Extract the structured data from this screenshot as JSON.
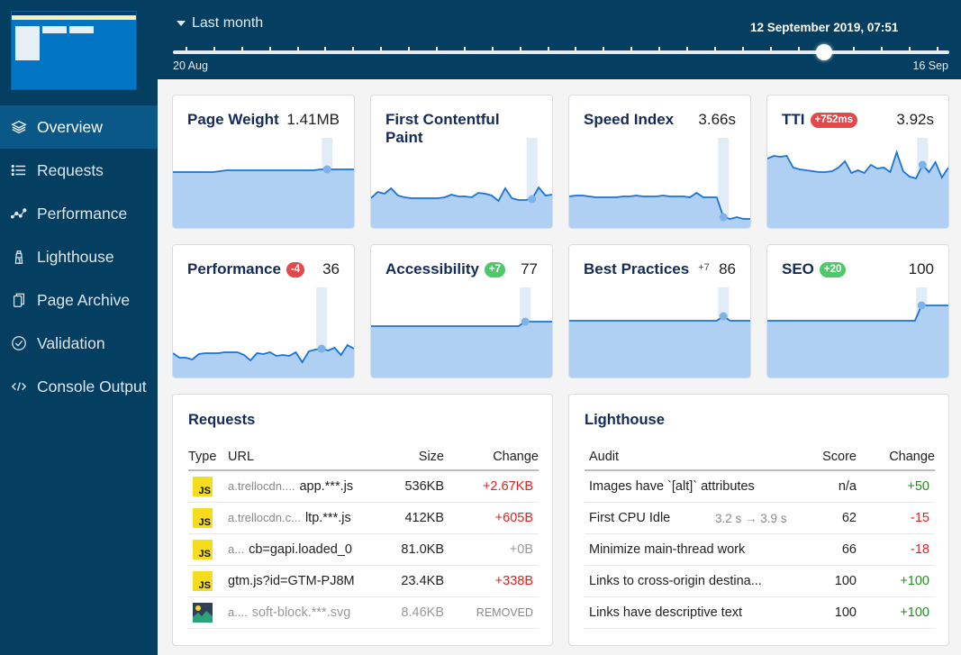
{
  "sidebar": {
    "items": [
      {
        "label": "Overview",
        "icon": "layers-icon",
        "active": true
      },
      {
        "label": "Requests",
        "icon": "list-icon",
        "active": false
      },
      {
        "label": "Performance",
        "icon": "chart-line-icon",
        "active": false
      },
      {
        "label": "Lighthouse",
        "icon": "lighthouse-icon",
        "active": false
      },
      {
        "label": "Page Archive",
        "icon": "copy-icon",
        "active": false
      },
      {
        "label": "Validation",
        "icon": "check-circle-icon",
        "active": false
      },
      {
        "label": "Console Output",
        "icon": "code-icon",
        "active": false
      }
    ]
  },
  "topbar": {
    "range_label": "Last month",
    "current_date": "12 September 2019, 07:51",
    "slider_start": "20 Aug",
    "slider_end": "16 Sep",
    "slider_ticks": 28,
    "slider_position": 0.85
  },
  "metrics": [
    {
      "title": "Page Weight",
      "value": "1.41MB",
      "badge": null,
      "badge_type": null,
      "series": [
        0.62,
        0.62,
        0.62,
        0.62,
        0.62,
        0.62,
        0.62,
        0.63,
        0.64,
        0.64,
        0.64,
        0.64,
        0.64,
        0.64,
        0.64,
        0.64,
        0.64,
        0.64,
        0.64,
        0.64,
        0.64,
        0.64,
        0.65,
        0.65,
        0.65,
        0.65,
        0.65,
        0.65
      ],
      "selected": 23
    },
    {
      "title": "First Contentful Paint",
      "value": "",
      "badge": null,
      "badge_type": null,
      "series": [
        0.33,
        0.4,
        0.38,
        0.44,
        0.36,
        0.34,
        0.33,
        0.33,
        0.33,
        0.33,
        0.33,
        0.34,
        0.37,
        0.35,
        0.35,
        0.34,
        0.39,
        0.38,
        0.36,
        0.3,
        0.44,
        0.33,
        0.31,
        0.31,
        0.32,
        0.45,
        0.36,
        0.37
      ],
      "selected": 24
    },
    {
      "title": "Speed Index",
      "value": "3.66s",
      "badge": null,
      "badge_type": null,
      "series": [
        0.35,
        0.36,
        0.36,
        0.35,
        0.34,
        0.34,
        0.34,
        0.34,
        0.35,
        0.35,
        0.36,
        0.35,
        0.35,
        0.35,
        0.36,
        0.35,
        0.35,
        0.35,
        0.34,
        0.39,
        0.34,
        0.34,
        0.34,
        0.12,
        0.1,
        0.12,
        0.1,
        0.1
      ],
      "selected": 23
    },
    {
      "title": "TTI",
      "value": "3.92s",
      "badge": "+752ms",
      "badge_type": "red",
      "series": [
        0.77,
        0.8,
        0.79,
        0.8,
        0.67,
        0.65,
        0.64,
        0.63,
        0.62,
        0.62,
        0.63,
        0.67,
        0.74,
        0.61,
        0.64,
        0.61,
        0.7,
        0.66,
        0.67,
        0.62,
        0.84,
        0.63,
        0.57,
        0.55,
        0.7,
        0.62,
        0.73,
        0.56,
        0.67
      ],
      "selected": 24
    },
    {
      "title": "Performance",
      "value": "36",
      "badge": "-4",
      "badge_type": "red",
      "series": [
        0.27,
        0.22,
        0.22,
        0.2,
        0.26,
        0.27,
        0.27,
        0.27,
        0.28,
        0.28,
        0.28,
        0.25,
        0.19,
        0.27,
        0.26,
        0.28,
        0.24,
        0.25,
        0.24,
        0.28,
        0.17,
        0.29,
        0.31,
        0.32,
        0.3,
        0.33,
        0.25,
        0.36,
        0.32
      ],
      "selected": 23
    },
    {
      "title": "Accessibility",
      "value": "77",
      "badge": "+7",
      "badge_type": "green",
      "series": [
        0.57,
        0.57,
        0.57,
        0.57,
        0.57,
        0.57,
        0.57,
        0.57,
        0.57,
        0.57,
        0.57,
        0.57,
        0.57,
        0.57,
        0.57,
        0.57,
        0.57,
        0.57,
        0.57,
        0.57,
        0.57,
        0.57,
        0.57,
        0.62,
        0.62,
        0.62,
        0.62,
        0.62
      ],
      "selected": 23
    },
    {
      "title": "Best Practices",
      "value": "86",
      "badge": "+7",
      "badge_type": "plain",
      "series": [
        0.63,
        0.63,
        0.63,
        0.63,
        0.63,
        0.63,
        0.63,
        0.63,
        0.63,
        0.63,
        0.63,
        0.63,
        0.63,
        0.63,
        0.63,
        0.63,
        0.63,
        0.63,
        0.63,
        0.63,
        0.63,
        0.63,
        0.63,
        0.68,
        0.63,
        0.63,
        0.63,
        0.63
      ],
      "selected": 23
    },
    {
      "title": "SEO",
      "value": "100",
      "badge": "+20",
      "badge_type": "green",
      "series": [
        0.63,
        0.63,
        0.63,
        0.63,
        0.63,
        0.63,
        0.63,
        0.63,
        0.63,
        0.63,
        0.63,
        0.63,
        0.63,
        0.63,
        0.63,
        0.63,
        0.63,
        0.63,
        0.63,
        0.63,
        0.63,
        0.63,
        0.63,
        0.8,
        0.8,
        0.8,
        0.8,
        0.8
      ],
      "selected": 23
    }
  ],
  "colors": {
    "sidebar_bg": "#043f62",
    "sidebar_active": "#0a5887",
    "spark_line": "#1a73d9",
    "spark_fill": "#afd0f2",
    "badge_red": "#e04a4a",
    "badge_green": "#4fc86a",
    "negative": "#e02222",
    "positive": "#1e8e1e"
  },
  "requests": {
    "title": "Requests",
    "headers": {
      "type": "Type",
      "url": "URL",
      "size": "Size",
      "change": "Change"
    },
    "rows": [
      {
        "type": "js",
        "domain": "a.trellocdn....",
        "file": "app.***.js",
        "size": "536KB",
        "change": "+2.67KB",
        "change_class": "neg",
        "removed": false
      },
      {
        "type": "js",
        "domain": "a.trellocdn.c...",
        "file": "ltp.***.js",
        "size": "412KB",
        "change": "+605B",
        "change_class": "neg",
        "removed": false
      },
      {
        "type": "js",
        "domain": "a...",
        "file": "cb=gapi.loaded_0",
        "size": "81.0KB",
        "change": "+0B",
        "change_class": "muted",
        "removed": false
      },
      {
        "type": "js",
        "domain": "",
        "file": "gtm.js?id=GTM-PJ8M",
        "size": "23.4KB",
        "change": "+338B",
        "change_class": "neg",
        "removed": false
      },
      {
        "type": "image",
        "domain": "a....",
        "file": "soft-block.***.svg",
        "size": "8.46KB",
        "change": "REMOVED",
        "change_class": "removed",
        "removed": true
      }
    ]
  },
  "lighthouse": {
    "title": "Lighthouse",
    "headers": {
      "audit": "Audit",
      "score": "Score",
      "change": "Change"
    },
    "rows": [
      {
        "audit": "Images have `[alt]` attributes",
        "detail": "",
        "score": "n/a",
        "change": "+50",
        "change_class": "pos"
      },
      {
        "audit": "First CPU Idle",
        "detail": "3.2 s → 3.9 s",
        "score": "62",
        "change": "-15",
        "change_class": "neg"
      },
      {
        "audit": "Minimize main-thread work",
        "detail": "",
        "score": "66",
        "change": "-18",
        "change_class": "neg"
      },
      {
        "audit": "Links to cross-origin destina...",
        "detail": "",
        "score": "100",
        "change": "+100",
        "change_class": "pos"
      },
      {
        "audit": "Links have descriptive text",
        "detail": "",
        "score": "100",
        "change": "+100",
        "change_class": "pos"
      }
    ]
  }
}
